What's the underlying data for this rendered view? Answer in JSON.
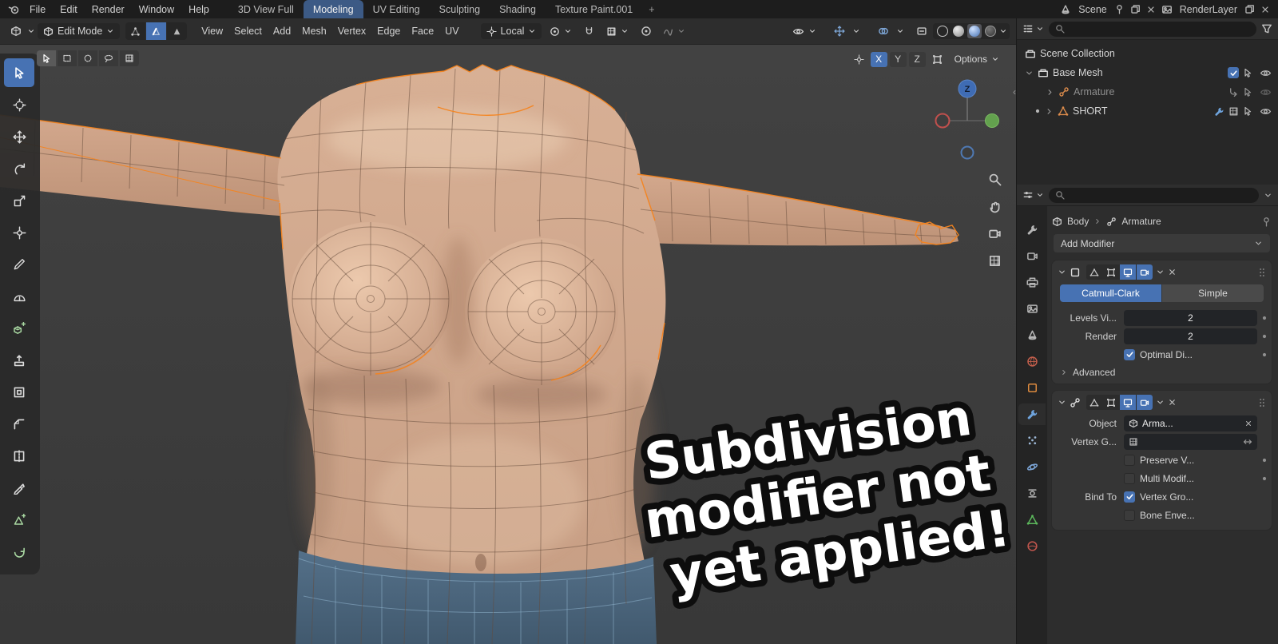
{
  "topbar": {
    "menus": [
      "File",
      "Edit",
      "Render",
      "Window",
      "Help"
    ],
    "workspaces": [
      "3D View Full",
      "Modeling",
      "UV Editing",
      "Sculpting",
      "Shading",
      "Texture Paint.001"
    ],
    "active_workspace": "Modeling",
    "add_tab": "+",
    "scene_label": "Scene",
    "render_layer_label": "RenderLayer"
  },
  "viewport": {
    "header": {
      "mode": "Edit Mode",
      "menus": [
        "View",
        "Select",
        "Add",
        "Mesh",
        "Vertex",
        "Edge",
        "Face",
        "UV"
      ],
      "orientation": "Local"
    },
    "axis": {
      "x": "X",
      "y": "Y",
      "z": "Z"
    },
    "active_axis": "X",
    "options_label": "Options",
    "gizmo_z": "Z",
    "overlay_lines": [
      "Subdivision",
      "modifier not",
      "yet applied!"
    ]
  },
  "outliner": {
    "rows": [
      {
        "label": "Scene Collection"
      },
      {
        "label": "Base Mesh"
      },
      {
        "label": "Armature"
      },
      {
        "label": "SHORT"
      }
    ]
  },
  "properties": {
    "breadcrumb": {
      "object": "Body",
      "data": "Armature"
    },
    "add_modifier": "Add Modifier",
    "subdivision": {
      "catmull_clark": "Catmull-Clark",
      "simple": "Simple",
      "levels_label": "Levels Vi...",
      "levels_value": "2",
      "render_label": "Render",
      "render_value": "2",
      "optimal_label": "Optimal Di...",
      "advanced_label": "Advanced"
    },
    "armature": {
      "object_label": "Object",
      "object_value": "Arma...",
      "vertex_group_label": "Vertex G...",
      "preserve_label": "Preserve V...",
      "multi_label": "Multi Modif...",
      "bind_to_label": "Bind To",
      "vertex_groups_label": "Vertex Gro...",
      "bone_envelopes_label": "Bone Enve..."
    }
  },
  "icons": {
    "search-icon": "magnifier circle+handle",
    "filter-icon": "funnel",
    "eye-icon": "visibility eye",
    "wrench-icon": "modifier wrench",
    "magnet-icon": "snapping magnet",
    "pin-icon": "pin",
    "close-icon": "x cross",
    "checkbox-check-icon": "check mark",
    "chevron-down-icon": "down caret",
    "chevron-right-icon": "right caret",
    "grip-icon": "drag dots",
    "camera-icon": "render camera",
    "monitor-icon": "display toggle"
  },
  "colors": {
    "accent": "#4772b3",
    "selected_edge": "#f5841f",
    "skin": "#cfa58c",
    "pants": "#4b6579",
    "active_tab": "#3c5a85"
  }
}
